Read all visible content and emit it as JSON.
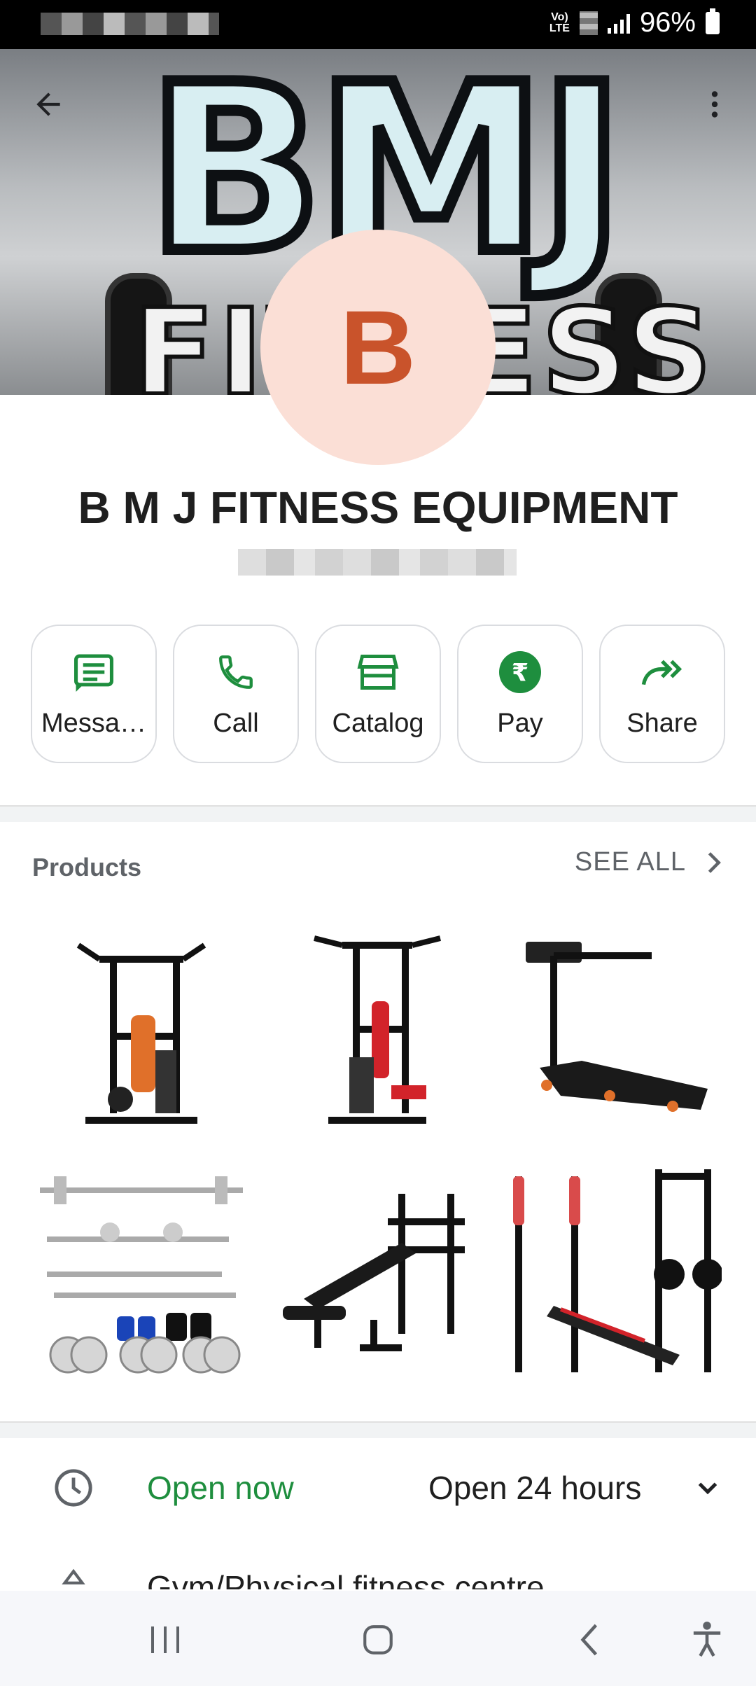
{
  "status_bar": {
    "battery": "96%",
    "network": "VoLTE"
  },
  "business": {
    "name": "B M J FITNESS EQUIPMENT",
    "avatar_letter": "B",
    "cover_text": "BMJ",
    "cover_sub": "FITNESS"
  },
  "actions": [
    {
      "label": "Messa…",
      "icon": "message-icon"
    },
    {
      "label": "Call",
      "icon": "phone-icon"
    },
    {
      "label": "Catalog",
      "icon": "store-icon"
    },
    {
      "label": "Pay",
      "icon": "rupee-icon"
    },
    {
      "label": "Share",
      "icon": "share-icon"
    }
  ],
  "products": {
    "title": "Products",
    "see_all": "SEE ALL",
    "items": [
      "home-gym-orange",
      "home-gym-red",
      "treadmill",
      "weight-set",
      "weight-bench",
      "multi-bench"
    ]
  },
  "hours": {
    "status": "Open now",
    "detail": "Open 24 hours"
  },
  "category": "Gym/Physical fitness centre",
  "colors": {
    "accent_green": "#1e8e3e",
    "avatar_bg": "#fbdfd6",
    "avatar_fg": "#c9532b"
  }
}
